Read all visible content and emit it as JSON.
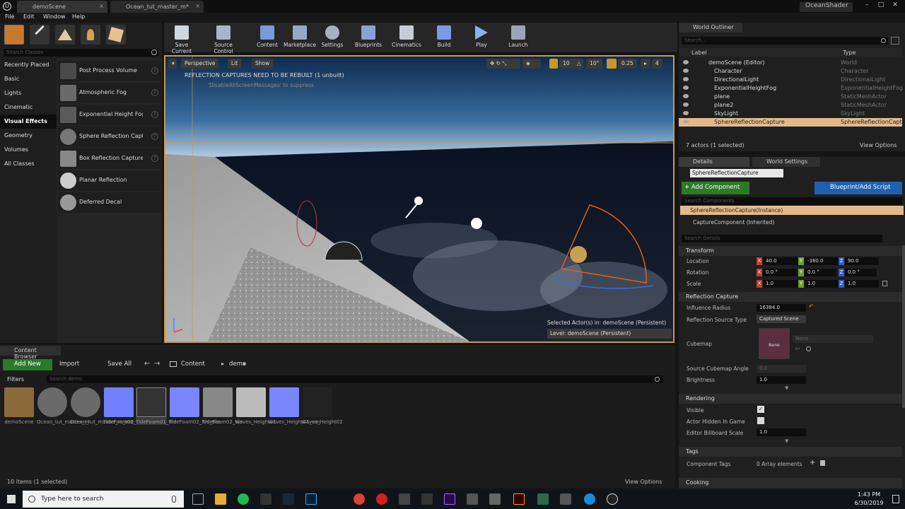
{
  "window": {
    "tabs": [
      "demoScene",
      "Ocean_tut_master_m*"
    ],
    "project": "OceanShader",
    "menu": [
      "File",
      "Edit",
      "Window",
      "Help"
    ]
  },
  "modes": {
    "search_placeholder": "Search Classes",
    "categories": [
      "Recently Placed",
      "Basic",
      "Lights",
      "Cinematic",
      "Visual Effects",
      "Geometry",
      "Volumes",
      "All Classes"
    ],
    "selected_category": "Visual Effects",
    "items": [
      "Post Process Volume",
      "Atmospheric Fog",
      "Exponential Height Fog",
      "Sphere Reflection Captur",
      "Box Reflection Capture",
      "Planar Reflection",
      "Deferred Decal"
    ]
  },
  "toolbar": {
    "buttons": [
      "Save Current",
      "Source Control",
      "Content",
      "Marketplace",
      "Settings",
      "Blueprints",
      "Cinematics",
      "Build",
      "Play",
      "Launch"
    ]
  },
  "viewport": {
    "perspective": "Perspective",
    "lit": "Lit",
    "show": "Show",
    "grid_snap": "10",
    "rot_snap": "10°",
    "scale_snap": "0.25",
    "camera_speed": "4",
    "warning": "REFLECTION CAPTURES NEED TO BE REBUILT (1 unbuilt)",
    "suppress": "'DisableAllScreenMessages' to suppress",
    "selected_info": "Selected Actor(s) in:  demoScene (Persistent)",
    "level": "Level:  demoScene (Persistent)"
  },
  "outliner": {
    "tab": "World Outliner",
    "search_placeholder": "Search...",
    "col_label": "Label",
    "col_type": "Type",
    "rows": [
      {
        "name": "demoScene (Editor)",
        "type": "World"
      },
      {
        "name": "Character",
        "type": "Character"
      },
      {
        "name": "DirectionalLight",
        "type": "DirectionalLight"
      },
      {
        "name": "ExponentialHeightFog",
        "type": "ExponentialHeightFog"
      },
      {
        "name": "plane",
        "type": "StaticMeshActor"
      },
      {
        "name": "plane2",
        "type": "StaticMeshActor"
      },
      {
        "name": "SkyLight",
        "type": "SkyLight"
      },
      {
        "name": "SphereReflectionCapture",
        "type": "SphereReflectionCaptur"
      }
    ],
    "footer": "7 actors (1 selected)",
    "view_options": "View Options"
  },
  "details": {
    "tab": "Details",
    "tab2": "World Settings",
    "object_name": "SphereReflectionCapture",
    "add_component": "+ Add Component",
    "blueprint_script": "Blueprint/Add Script",
    "search_components": "Search Components",
    "component_instance": "SphereReflectionCapture(Instance)",
    "component_child": "CaptureComponent (Inherited)",
    "search_details": "Search Details",
    "transform": "Transform",
    "location_label": "Location",
    "rotation_label": "Rotation",
    "scale_label": "Scale",
    "location": [
      "40.0",
      "-380.0",
      "90.0"
    ],
    "rotation": [
      "0.0 °",
      "0.0 °",
      "0.0 °"
    ],
    "scale": [
      "1.0",
      "1.0",
      "1.0"
    ],
    "reflection_capture": "Reflection Capture",
    "influence_radius_label": "Influence Radius",
    "influence_radius": "16384.0",
    "reflection_source_label": "Reflection Source Type",
    "reflection_source": "Captured Scene",
    "cubemap_label": "Cubemap",
    "cubemap_none": "None",
    "cubemap_select": "None",
    "source_cubemap_angle_label": "Source Cubemap Angle",
    "source_cubemap_angle": "0.0",
    "brightness_label": "Brightness",
    "brightness": "1.0",
    "rendering": "Rendering",
    "visible_label": "Visible",
    "actor_hidden_label": "Actor Hidden In Game",
    "billboard_scale_label": "Editor Billboard Scale",
    "billboard_scale": "1.0",
    "tags": "Tags",
    "component_tags_label": "Component Tags",
    "component_tags": "0 Array elements",
    "cooking": "Cooking"
  },
  "content_browser": {
    "tab": "Content Browser",
    "add_new": "Add New",
    "import": "Import",
    "save_all": "Save All",
    "path_root": "Content",
    "path_folder": "demo",
    "filters": "Filters",
    "search_placeholder": "Search demo",
    "assets": [
      {
        "name": "demoScene",
        "color": "#8a6a3a"
      },
      {
        "name": "Ocean_tut_master_m",
        "color": "#6a6a6a"
      },
      {
        "name": "Ocean_tut_master_m_inst",
        "color": "#6a6a6a"
      },
      {
        "name": "TideFoam01_nm_tile",
        "color": "#7080ff"
      },
      {
        "name": "TideFoam01_tile",
        "color": "#333"
      },
      {
        "name": "TideFoam02_nm_tile",
        "color": "#7a86ff"
      },
      {
        "name": "TideFoam02_tile",
        "color": "#888"
      },
      {
        "name": "waves_Height01",
        "color": "#bbb"
      },
      {
        "name": "waves_Height01_nm",
        "color": "#7a86ff"
      },
      {
        "name": "waves_Height02",
        "color": "#222"
      }
    ],
    "footer": "10 items (1 selected)",
    "view_options": "View Options"
  },
  "taskbar": {
    "search_placeholder": "Type here to search",
    "time": "1:43 PM",
    "date": "6/30/2019"
  }
}
